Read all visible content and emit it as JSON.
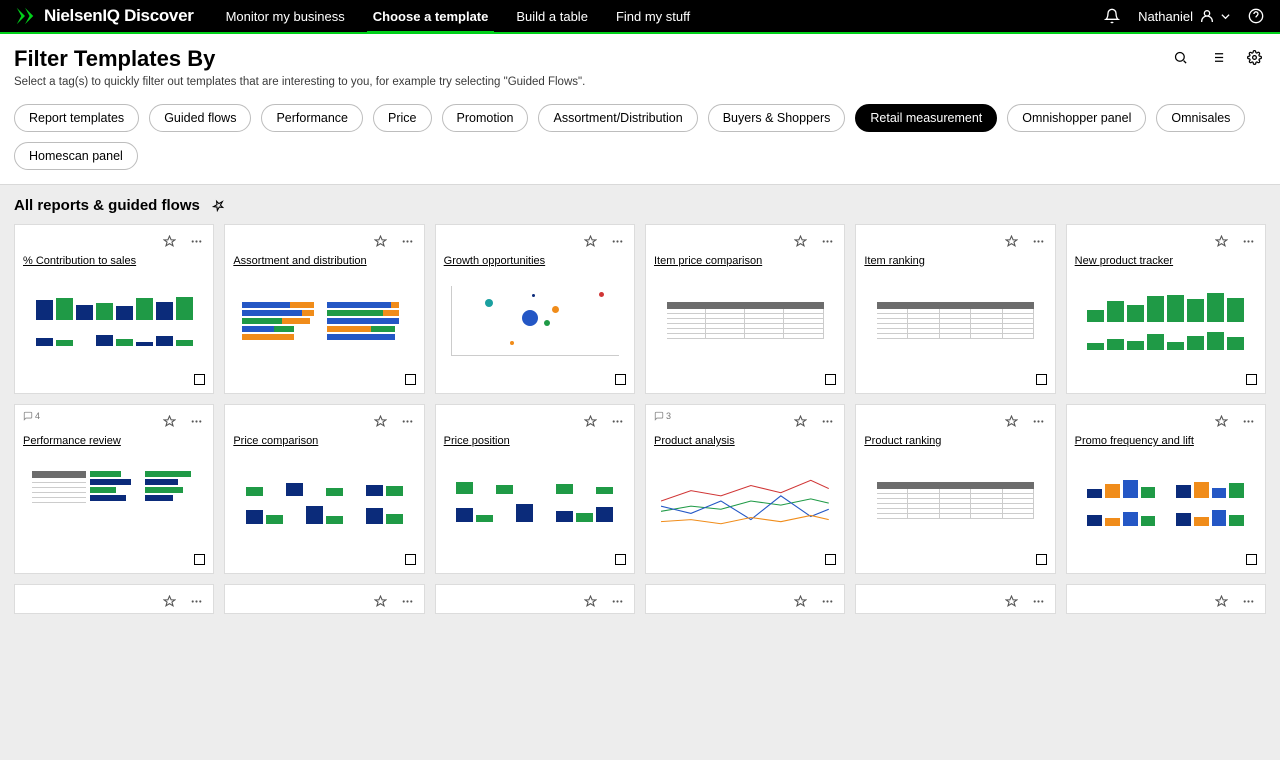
{
  "brand": "NielsenIQ Discover",
  "nav": [
    {
      "label": "Monitor my business",
      "active": false
    },
    {
      "label": "Choose a template",
      "active": true
    },
    {
      "label": "Build a table",
      "active": false
    },
    {
      "label": "Find my stuff",
      "active": false
    }
  ],
  "user": "Nathaniel",
  "header": {
    "title": "Filter Templates By",
    "subtitle": "Select a tag(s) to quickly filter out templates that are interesting to you, for example try selecting \"Guided Flows\"."
  },
  "chips": [
    {
      "label": "Report templates",
      "active": false
    },
    {
      "label": "Guided flows",
      "active": false
    },
    {
      "label": "Performance",
      "active": false
    },
    {
      "label": "Price",
      "active": false
    },
    {
      "label": "Promotion",
      "active": false
    },
    {
      "label": "Assortment/Distribution",
      "active": false
    },
    {
      "label": "Buyers & Shoppers",
      "active": false
    },
    {
      "label": "Retail measurement",
      "active": true
    },
    {
      "label": "Omnishopper panel",
      "active": false
    },
    {
      "label": "Omnisales",
      "active": false
    },
    {
      "label": "Homescan panel",
      "active": false
    }
  ],
  "section_title": "All reports & guided flows",
  "cards_row1": [
    {
      "title": "% Contribution to sales"
    },
    {
      "title": "Assortment and distribution"
    },
    {
      "title": "Growth opportunities"
    },
    {
      "title": "Item price comparison"
    },
    {
      "title": "Item ranking"
    },
    {
      "title": "New product tracker"
    }
  ],
  "cards_row2": [
    {
      "title": "Performance review",
      "badge": "4"
    },
    {
      "title": "Price comparison"
    },
    {
      "title": "Price position"
    },
    {
      "title": "Product analysis",
      "badge": "3"
    },
    {
      "title": "Product ranking"
    },
    {
      "title": "Promo frequency and lift"
    }
  ],
  "colors": {
    "green": "#1f9a46",
    "blue": "#2457c5",
    "orange": "#f08c1a",
    "teal": "#1aa0a0",
    "red": "#d03535",
    "darkblue": "#0b2b7a"
  }
}
